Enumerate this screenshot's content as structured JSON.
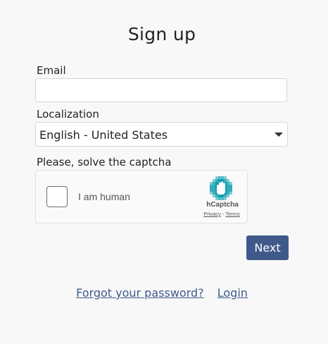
{
  "page": {
    "title": "Sign up"
  },
  "form": {
    "email_label": "Email",
    "email_value": "",
    "email_placeholder": "",
    "localization_label": "Localization",
    "localization_value": "English - United States",
    "captcha_label": "Please, solve the captcha"
  },
  "captcha": {
    "checkbox_text": "I am human",
    "brand": "hCaptcha",
    "privacy_link": "Privacy",
    "separator": " - ",
    "terms_link": "Terms",
    "brand_color": "#00838f"
  },
  "actions": {
    "next_label": "Next",
    "forgot_password_label": "Forgot your password?",
    "login_label": "Login"
  },
  "colors": {
    "primary": "#3f5a8a",
    "background": "#f8f8f8"
  }
}
